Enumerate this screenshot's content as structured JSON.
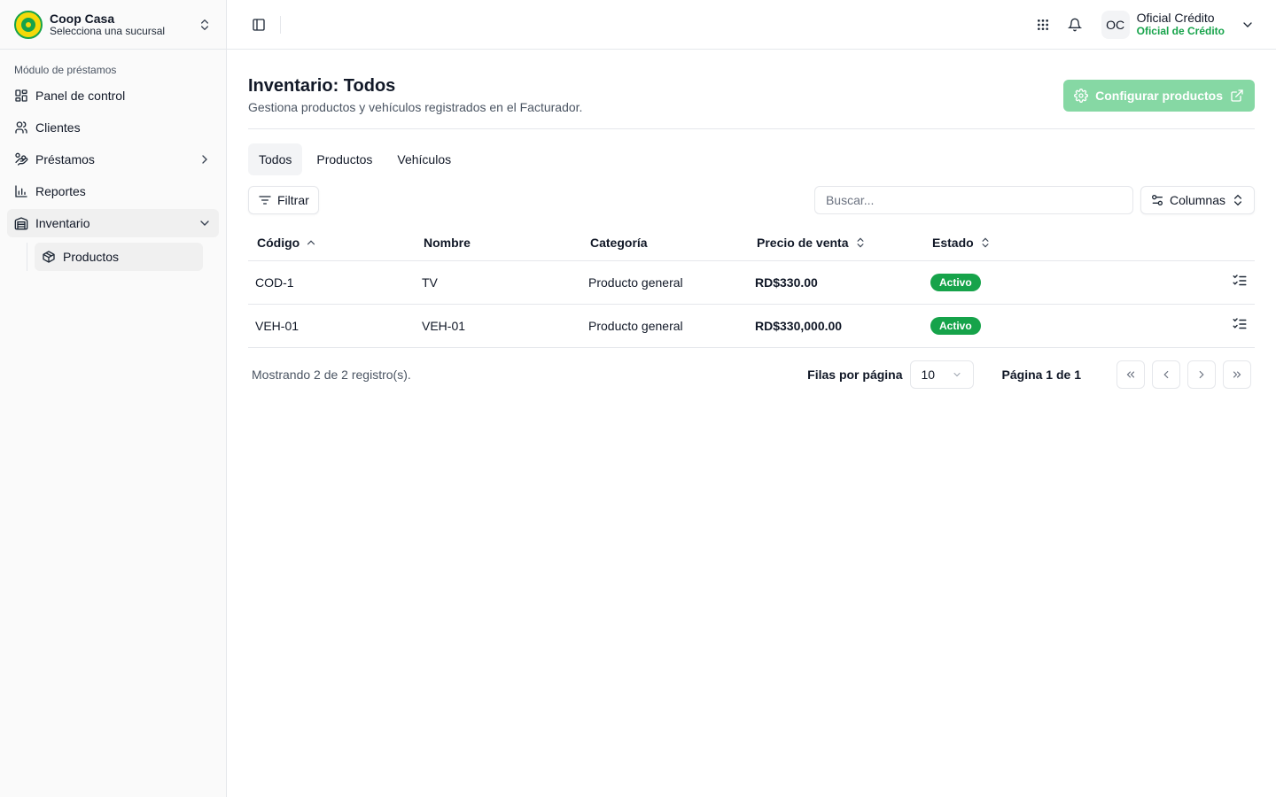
{
  "sidebar": {
    "org_name": "Coop Casa",
    "org_sub": "Selecciona una sucursal",
    "section_label": "Módulo de préstamos",
    "items": [
      {
        "label": "Panel de control"
      },
      {
        "label": "Clientes"
      },
      {
        "label": "Préstamos"
      },
      {
        "label": "Reportes"
      },
      {
        "label": "Inventario"
      }
    ],
    "subitems": [
      {
        "label": "Productos"
      }
    ]
  },
  "topbar": {
    "avatar_initials": "OC",
    "user_name": "Oficial Crédito",
    "user_role": "Oficial de Crédito"
  },
  "page": {
    "title": "Inventario: Todos",
    "subtitle": "Gestiona productos y vehículos registrados en el Facturador.",
    "config_button": "Configurar productos"
  },
  "tabs": [
    {
      "label": "Todos",
      "active": true
    },
    {
      "label": "Productos",
      "active": false
    },
    {
      "label": "Vehículos",
      "active": false
    }
  ],
  "toolbar": {
    "filter_label": "Filtrar",
    "search_placeholder": "Buscar...",
    "columns_label": "Columnas"
  },
  "table": {
    "columns": [
      "Código",
      "Nombre",
      "Categoría",
      "Precio de venta",
      "Estado"
    ],
    "rows": [
      {
        "code": "COD-1",
        "name": "TV",
        "category": "Producto general",
        "price": "RD$330.00",
        "status": "Activo"
      },
      {
        "code": "VEH-01",
        "name": "VEH-01",
        "category": "Producto general",
        "price": "RD$330,000.00",
        "status": "Activo"
      }
    ]
  },
  "pagination": {
    "info": "Mostrando 2 de 2 registro(s).",
    "rows_per_page_label": "Filas por página",
    "rows_per_page_value": "10",
    "page_label": "Página 1 de 1"
  },
  "colors": {
    "accent": "#16a34a",
    "config_button_bg": "#86d8a4"
  }
}
